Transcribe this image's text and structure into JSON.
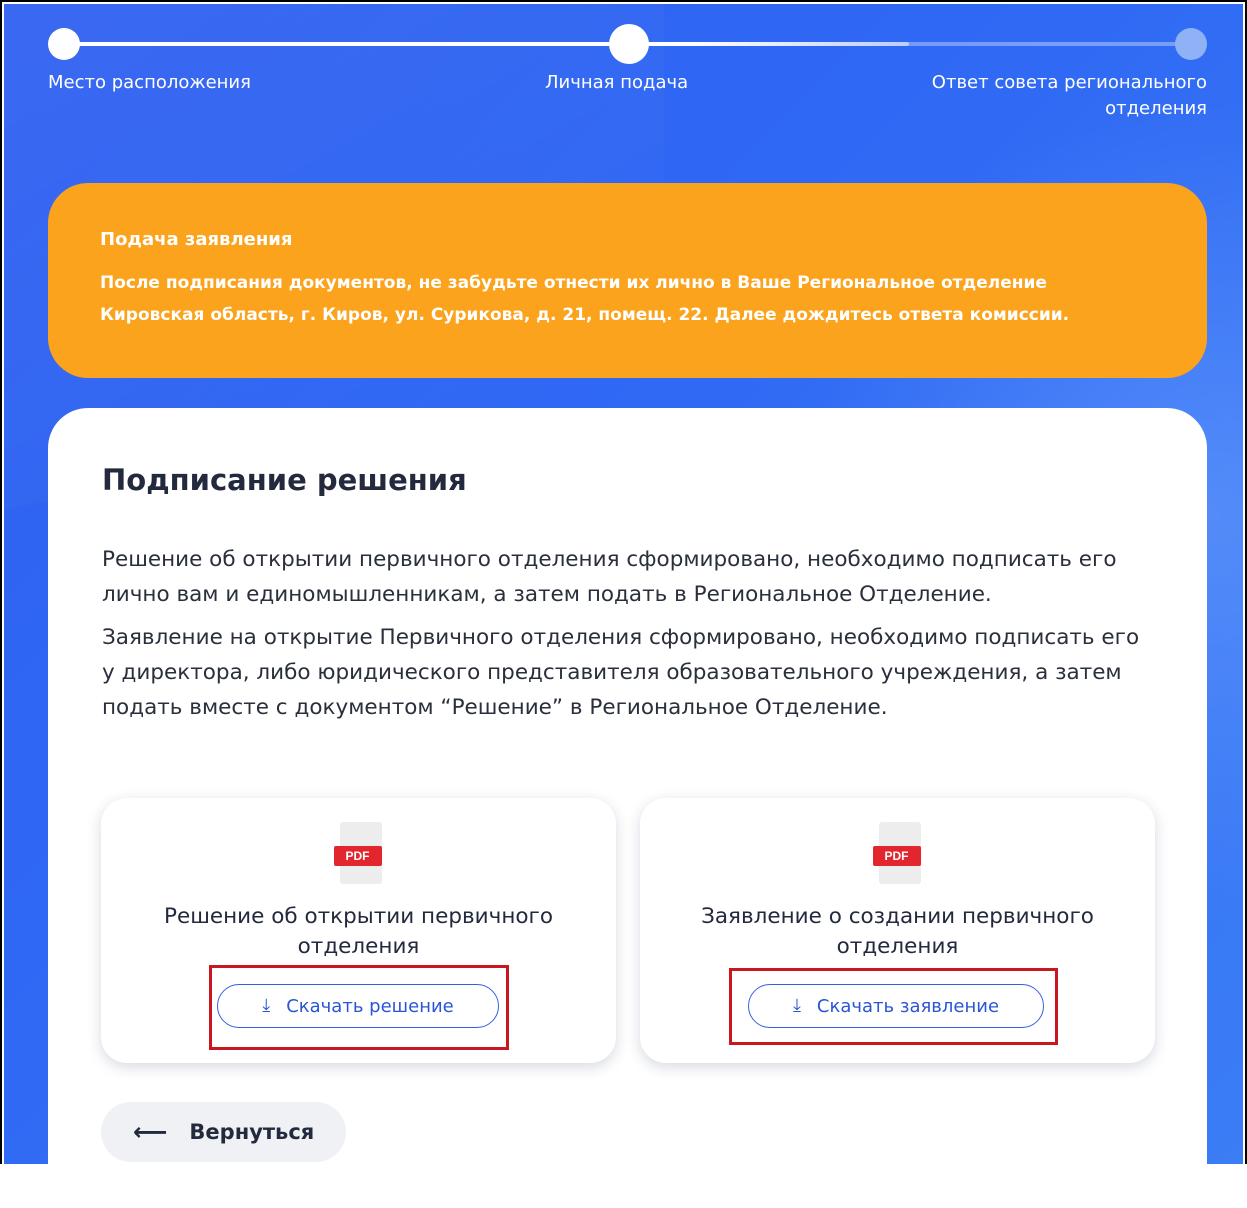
{
  "stepper": {
    "steps": [
      {
        "label": "Место расположения",
        "state": "done"
      },
      {
        "label": "Личная подача",
        "state": "current"
      },
      {
        "label": "Ответ совета регионального отделения",
        "state": "pending"
      }
    ]
  },
  "notice": {
    "title": "Подача заявления",
    "text": "После подписания документов, не забудьте отнести их лично в Ваше Региональное отделение Кировская область, г. Киров, ул. Сурикова, д. 21, помещ. 22. Далее дождитесь ответа комиссии."
  },
  "card": {
    "title": "Подписание решения",
    "paragraph1": "Решение об открытии первичного отделения сформировано, необходимо подписать его лично вам и единомышленникам, а затем подать в Региональное Отделение.",
    "paragraph2": "Заявление на открытие Первичного отделения сформировано, необходимо подписать его у директора, либо юридического представителя образовательного учреждения, а затем подать вместе с документом “Решение” в Региональное Отделение."
  },
  "documents": [
    {
      "icon": "pdf-icon",
      "badge": "PDF",
      "title": "Решение об открытии первичного отделения",
      "button": "Скачать решение"
    },
    {
      "icon": "pdf-icon",
      "badge": "PDF",
      "title": "Заявление о создании первичного отделения",
      "button": "Скачать заявление"
    }
  ],
  "back_button": {
    "label": "Вернуться",
    "icon": "arrow-left-icon"
  },
  "colors": {
    "background": "#2f62f2",
    "notice": "#fba31c",
    "accent": "#3160e8",
    "highlight": "#c8171e",
    "pdf_badge": "#e3262d"
  }
}
